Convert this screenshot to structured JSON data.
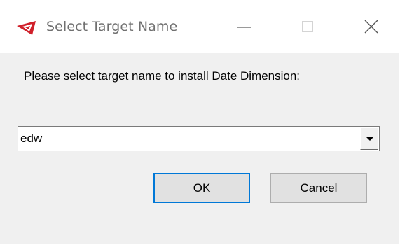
{
  "window": {
    "title": "Select Target Name",
    "title_color": "#707070",
    "icon": "app-logo-icon"
  },
  "titlebar_buttons": {
    "minimize_icon": "minimize-icon",
    "maximize_icon": "maximize-icon",
    "close_glyph": "✕",
    "close_icon": "close-icon"
  },
  "dialog": {
    "prompt": "Please select target name to install Date Dimension:",
    "target_select": {
      "selected_value": "edw",
      "dropdown_icon": "dropdown-arrow-icon"
    },
    "ok_label": "OK",
    "cancel_label": "Cancel"
  },
  "colors": {
    "focus_border": "#0078d7",
    "button_face": "#e1e1e1",
    "dialog_bg": "#f0f0f0",
    "logo_red": "#d0202a"
  }
}
